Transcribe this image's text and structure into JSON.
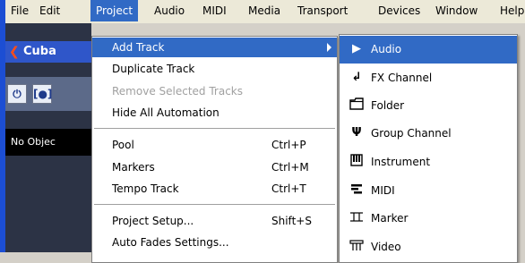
{
  "menubar": {
    "items": [
      "File",
      "Edit",
      "Project",
      "Audio",
      "MIDI",
      "Media",
      "Transport",
      "Devices",
      "Window",
      "Help"
    ],
    "active": "Project"
  },
  "app": {
    "title": "Cuba",
    "no_object_text": "No Objec"
  },
  "project_menu": {
    "items": [
      {
        "label": "Add Track",
        "shortcut": "",
        "state": "highlighted",
        "submenu": true
      },
      {
        "label": "Duplicate Track",
        "shortcut": "",
        "state": "normal"
      },
      {
        "label": "Remove Selected Tracks",
        "shortcut": "",
        "state": "disabled"
      },
      {
        "label": "Hide All Automation",
        "shortcut": "",
        "state": "normal"
      },
      {
        "label": "Pool",
        "shortcut": "Ctrl+P",
        "state": "normal"
      },
      {
        "label": "Markers",
        "shortcut": "Ctrl+M",
        "state": "normal"
      },
      {
        "label": "Tempo Track",
        "shortcut": "Ctrl+T",
        "state": "normal"
      },
      {
        "label": "Project Setup...",
        "shortcut": "Shift+S",
        "state": "normal"
      },
      {
        "label": "Auto Fades Settings...",
        "shortcut": "",
        "state": "normal"
      }
    ]
  },
  "add_track_submenu": {
    "items": [
      {
        "label": "Audio",
        "icon": "play-arrow-icon",
        "state": "highlighted"
      },
      {
        "label": "FX Channel",
        "icon": "fx-channel-icon",
        "state": "normal"
      },
      {
        "label": "Folder",
        "icon": "folder-icon",
        "state": "normal"
      },
      {
        "label": "Group Channel",
        "icon": "group-channel-icon",
        "state": "normal"
      },
      {
        "label": "Instrument",
        "icon": "instrument-icon",
        "state": "normal"
      },
      {
        "label": "MIDI",
        "icon": "midi-icon",
        "state": "normal"
      },
      {
        "label": "Marker",
        "icon": "marker-icon",
        "state": "normal"
      },
      {
        "label": "Video",
        "icon": "video-icon",
        "state": "normal"
      }
    ]
  },
  "colors": {
    "highlight": "#316ac5",
    "menubar_bg": "#ece9d8",
    "app_title_bg": "#2f56c9",
    "app_bg": "#2c3345"
  }
}
